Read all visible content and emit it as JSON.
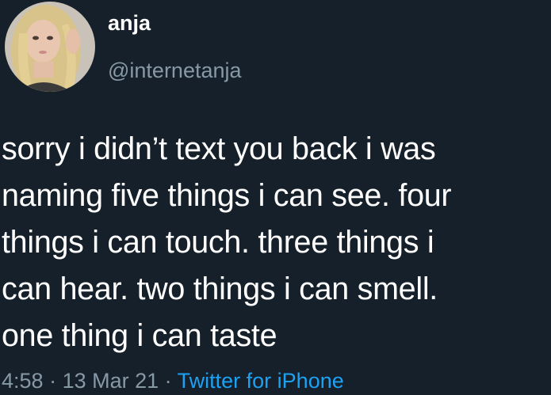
{
  "user": {
    "display_name": "anja",
    "handle": "@internetanja"
  },
  "tweet": {
    "text": "sorry i didn’t text you back i was\nnaming five things i can see. four\nthings i can touch. three things i\ncan hear. two things i can smell.\none thing i can taste"
  },
  "meta": {
    "time": "4:58",
    "separator": " · ",
    "date": "13 Mar 21",
    "source": "Twitter for iPhone"
  },
  "colors": {
    "background": "#15202b",
    "text": "#ffffff",
    "muted": "#8899a6",
    "link": "#1da1f2"
  }
}
